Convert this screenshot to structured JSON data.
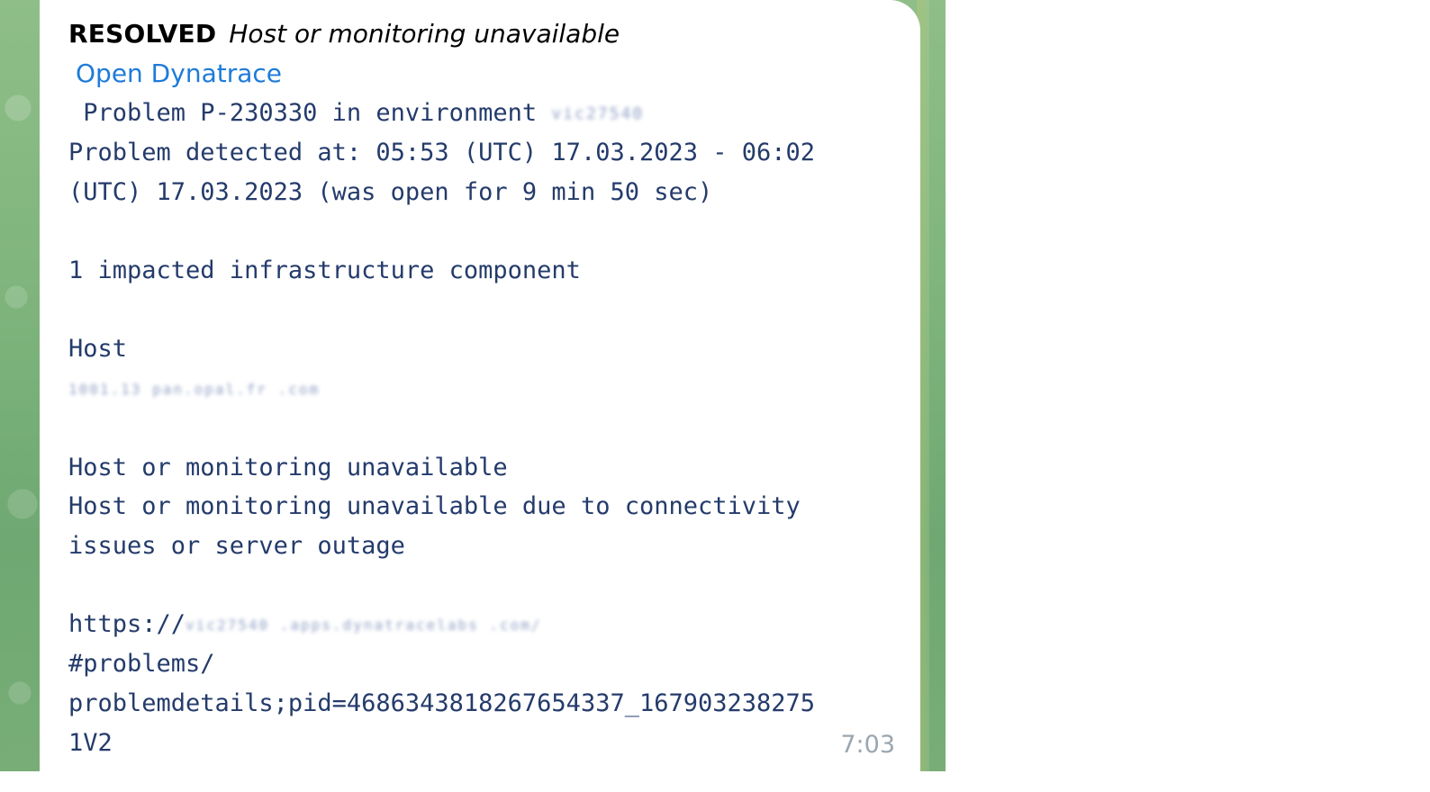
{
  "message": {
    "status": "RESOLVED",
    "subject": "Host or monitoring unavailable",
    "link_label": "Open Dynatrace",
    "problem_prefix": " Problem P-230330 in environment ",
    "environment_redacted": "vic27540",
    "detected_line_1": "Problem detected at: 05:53 (UTC) 17.03.2023 - 06:02",
    "detected_line_2": "(UTC) 17.03.2023 (was open for 9 min 50 sec)",
    "impact": "1 impacted infrastructure component",
    "host_label": "Host",
    "host_redacted": "1001.13 pan.opal.fr .com",
    "event_title": "Host or monitoring unavailable",
    "event_desc_1": "Host or monitoring unavailable due to connectivity",
    "event_desc_2": "issues or server outage",
    "url_prefix": "https://",
    "url_redacted": "vic27540 .apps.dynatracelabs .com/",
    "url_line_2": "#problems/",
    "url_line_3": "problemdetails;pid=4686343818267654337_167903238275",
    "url_line_4": "1V2",
    "time": "7:03"
  }
}
